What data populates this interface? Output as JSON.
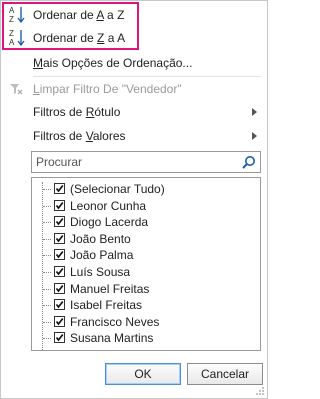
{
  "menu": {
    "sort_asc": {
      "prefix": "Ordenar de ",
      "from": "A",
      "mid": " a ",
      "to": "Z"
    },
    "sort_desc": {
      "prefix": "Ordenar de ",
      "from": "Z",
      "mid": " a ",
      "to": "A"
    },
    "more_sort": {
      "key": "M",
      "rest": "ais Opções de Ordenação..."
    },
    "clear_filter": {
      "key": "L",
      "rest": "impar Filtro De \"Vendedor\""
    },
    "label_filters": {
      "before": "Filtros de ",
      "key": "R",
      "rest": "ótulo"
    },
    "value_filters": {
      "before": "Filtros de ",
      "key": "V",
      "rest": "alores"
    }
  },
  "search": {
    "placeholder": "Procurar"
  },
  "list": {
    "items": [
      {
        "label": "(Selecionar Tudo)",
        "checked": true
      },
      {
        "label": "Leonor Cunha",
        "checked": true
      },
      {
        "label": "Diogo Lacerda",
        "checked": true
      },
      {
        "label": "João Bento",
        "checked": true
      },
      {
        "label": "João Palma",
        "checked": true
      },
      {
        "label": "Luís Sousa",
        "checked": true
      },
      {
        "label": "Manuel Freitas",
        "checked": true
      },
      {
        "label": "Isabel Freitas",
        "checked": true
      },
      {
        "label": "Francisco Neves",
        "checked": true
      },
      {
        "label": "Susana Martins",
        "checked": true
      }
    ]
  },
  "buttons": {
    "ok": "OK",
    "cancel": "Cancelar"
  },
  "colors": {
    "highlight": "#e0147a",
    "sort_arrow": "#1f5fa8"
  }
}
